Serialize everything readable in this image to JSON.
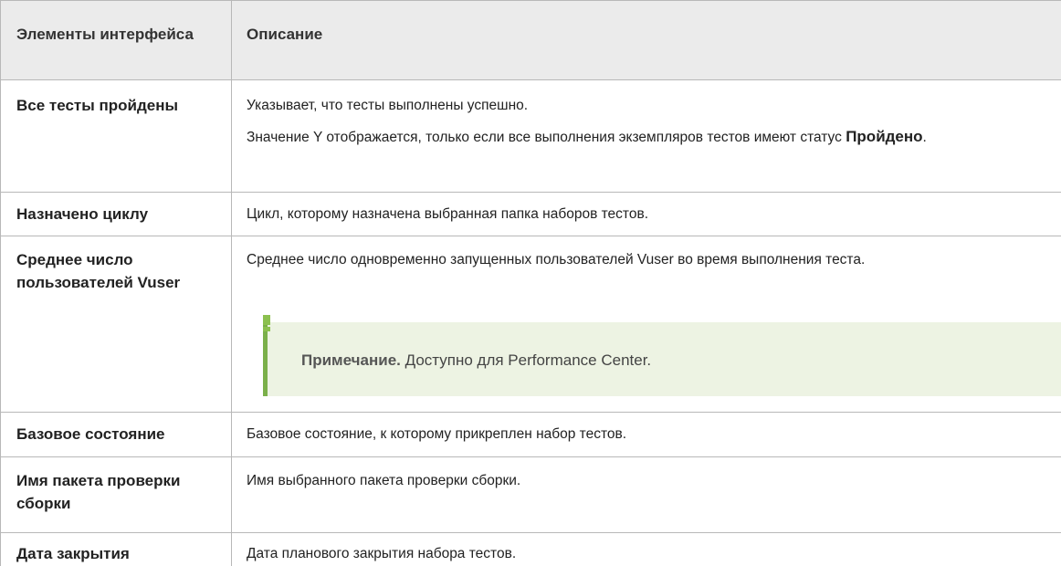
{
  "header": {
    "col1": "Элементы интерфейса",
    "col2": "Описание"
  },
  "rows": [
    {
      "term": "Все тесты пройдены",
      "desc1": "Указывает, что тесты выполнены успешно.",
      "desc2_pre": "Значение Y отображается, только если все выполнения экземпляров тестов имеют статус ",
      "desc2_bold": "Пройдено",
      "desc2_post": "."
    },
    {
      "term": "Назначено циклу",
      "desc": "Цикл, которому назначена выбранная папка наборов тестов."
    },
    {
      "term": "Среднее число пользователей Vuser",
      "desc": "Среднее число одновременно запущенных пользователей Vuser во время выполнения теста.",
      "note_label": "Примечание.",
      "note_text": "Доступно для Performance Center."
    },
    {
      "term": "Базовое состояние",
      "desc": "Базовое состояние, к которому прикреплен набор тестов."
    },
    {
      "term": "Имя пакета проверки сборки",
      "desc": "Имя выбранного пакета проверки сборки."
    },
    {
      "term": "Дата закрытия",
      "desc": "Дата планового закрытия набора тестов."
    }
  ],
  "colors": {
    "header_bg": "#ebebeb",
    "grid": "#b8b8b8",
    "note_bg": "#edf3e3",
    "note_bar": "#7bb04a"
  }
}
